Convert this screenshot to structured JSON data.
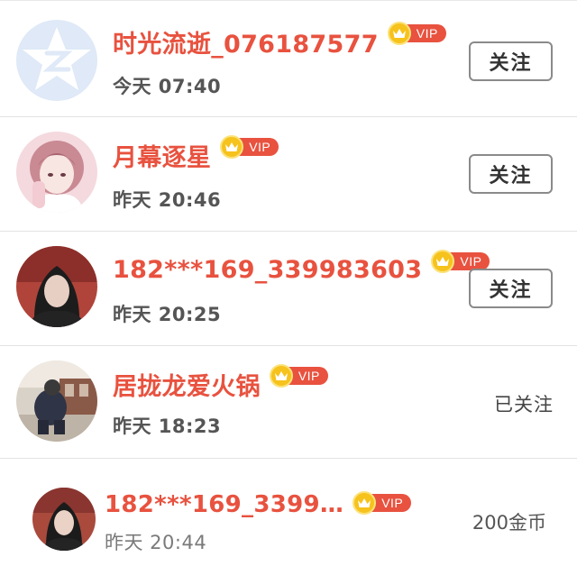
{
  "rows": [
    {
      "name": "时光流逝_076187577",
      "vip_label": "VIP",
      "time": "今天 07:40",
      "action_label": "关注"
    },
    {
      "name": "月幕逐星",
      "vip_label": "VIP",
      "time": "昨天 20:46",
      "action_label": "关注"
    },
    {
      "name": "182***169_339983603",
      "vip_label": "VIP",
      "time": "昨天 20:25",
      "action_label": "关注"
    },
    {
      "name": "居拢龙爱火锅",
      "vip_label": "VIP",
      "time": "昨天 18:23",
      "status_label": "已关注"
    },
    {
      "name": "182***169_3399…",
      "vip_label": "VIP",
      "time": "昨天 20:44",
      "reward_label": "200金币"
    }
  ],
  "colors": {
    "name": "#e8523f",
    "vip_badge": "#e8523f",
    "crown": "#f6c21c",
    "button_border": "#8a8a8a"
  },
  "icons": {
    "crown": "crown-icon",
    "default_avatar": "qq-star-avatar"
  }
}
